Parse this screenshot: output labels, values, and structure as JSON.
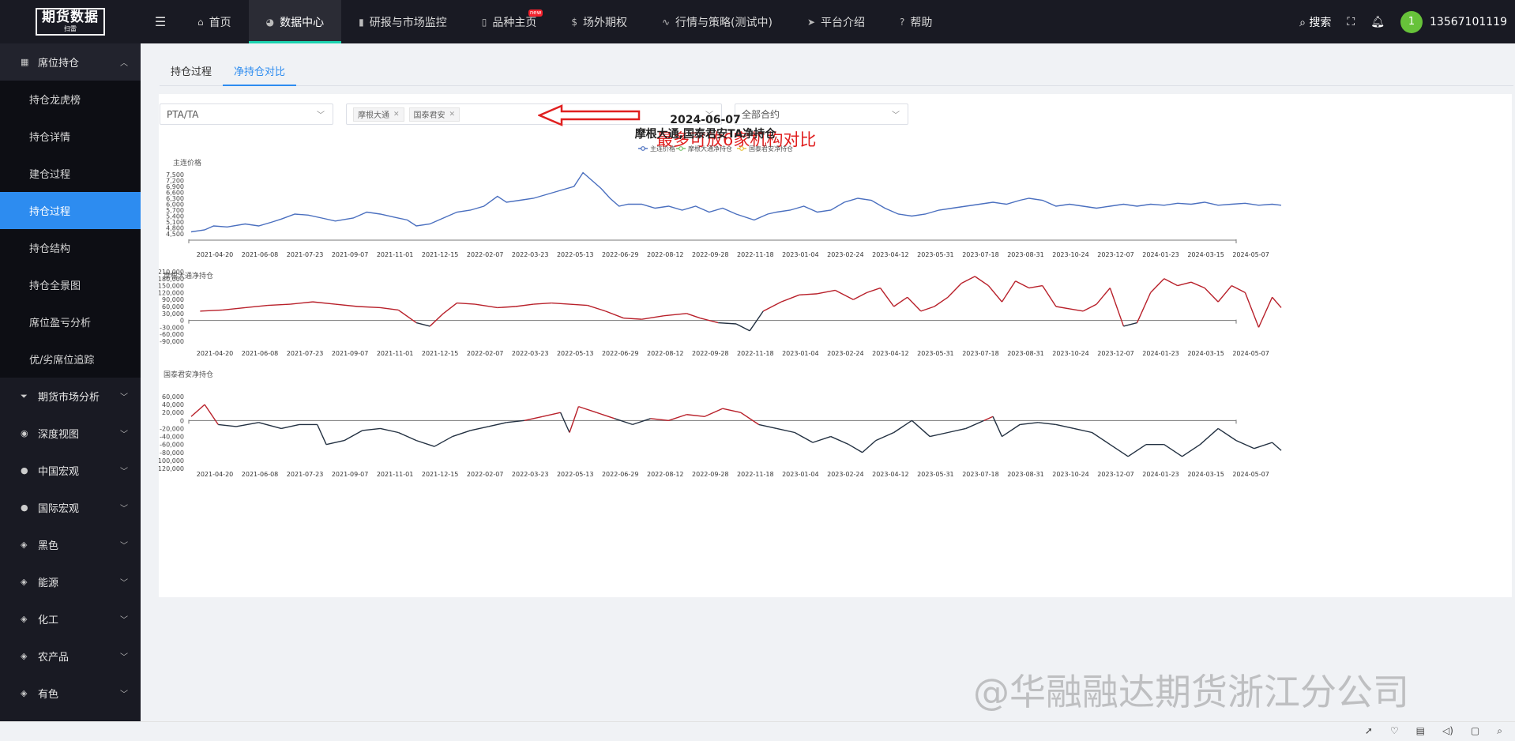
{
  "logo": {
    "title": "期货数据",
    "subtitle": "扫雷"
  },
  "nav": {
    "items": [
      {
        "label": "首页",
        "icon": "home-icon",
        "glyph": "⌂"
      },
      {
        "label": "数据中心",
        "icon": "pie-icon",
        "glyph": "◕"
      },
      {
        "label": "研报与市场监控",
        "icon": "bar-chart-icon",
        "glyph": "▮"
      },
      {
        "label": "品种主页",
        "icon": "book-icon",
        "glyph": "▯",
        "badge": "new"
      },
      {
        "label": "场外期权",
        "icon": "dollar-icon",
        "glyph": "$"
      },
      {
        "label": "行情与策略(测试中)",
        "icon": "pulse-icon",
        "glyph": "∿"
      },
      {
        "label": "平台介绍",
        "icon": "send-icon",
        "glyph": "➤"
      },
      {
        "label": "帮助",
        "icon": "help-icon",
        "glyph": "?"
      }
    ],
    "active_index": 1
  },
  "topright": {
    "search_label": "搜索",
    "avatar_text": "1",
    "username": "13567101119"
  },
  "sidebar": {
    "open_group": "席位持仓",
    "sub_items": [
      "持仓龙虎榜",
      "持仓详情",
      "建仓过程",
      "持仓过程",
      "持仓结构",
      "持仓全景图",
      "席位盈亏分析",
      "优/劣席位追踪"
    ],
    "active_sub": 3,
    "groups": [
      {
        "label": "期货市场分析",
        "icon": "funnel-icon"
      },
      {
        "label": "深度视图",
        "icon": "eye-icon"
      },
      {
        "label": "中国宏观",
        "icon": "dot-icon"
      },
      {
        "label": "国际宏观",
        "icon": "dot-icon"
      },
      {
        "label": "黑色",
        "icon": "cube-icon"
      },
      {
        "label": "能源",
        "icon": "cube-icon"
      },
      {
        "label": "化工",
        "icon": "cube-icon"
      },
      {
        "label": "农产品",
        "icon": "cube-icon"
      },
      {
        "label": "有色",
        "icon": "cube-icon"
      }
    ]
  },
  "tabs": [
    {
      "label": "持仓过程"
    },
    {
      "label": "净持仓对比"
    }
  ],
  "active_tab": 1,
  "filters": {
    "variety": "PTA/TA",
    "institutions": [
      "摩根大通",
      "国泰君安"
    ],
    "contract": "全部合约",
    "annotation": "最多可放6家机构对比"
  },
  "chart_data": {
    "type": "line",
    "title": "2024-06-07",
    "subtitle": "摩根大通,国泰君安TA净持仓",
    "legend": [
      "主连价格",
      "摩根大通净持仓",
      "国泰君安净持仓"
    ],
    "legend_position": "top-center",
    "colors": {
      "price": "#4a6fbf",
      "positive": "#b8202a",
      "negative": "#223041",
      "axis": "#777777"
    },
    "x_ticks": [
      "2021-04-20",
      "2021-06-08",
      "2021-07-23",
      "2021-09-07",
      "2021-11-01",
      "2021-12-15",
      "2022-02-07",
      "2022-03-23",
      "2022-05-13",
      "2022-06-29",
      "2022-08-12",
      "2022-09-28",
      "2022-11-18",
      "2023-01-04",
      "2023-02-24",
      "2023-04-12",
      "2023-05-31",
      "2023-07-18",
      "2023-08-31",
      "2023-10-24",
      "2023-12-07",
      "2024-01-23",
      "2024-03-15",
      "2024-05-07"
    ],
    "panels": [
      {
        "name": "主连价格",
        "ylabel": "主连价格",
        "y_ticks": [
          4500,
          4800,
          5100,
          5400,
          5700,
          6000,
          6300,
          6600,
          6900,
          7200,
          7500
        ],
        "ylim": [
          4500,
          7800
        ],
        "points": [
          [
            0,
            4600
          ],
          [
            0.3,
            4700
          ],
          [
            0.5,
            4900
          ],
          [
            0.8,
            4850
          ],
          [
            1.2,
            5000
          ],
          [
            1.5,
            4900
          ],
          [
            1.8,
            5100
          ],
          [
            2.0,
            5250
          ],
          [
            2.3,
            5500
          ],
          [
            2.6,
            5450
          ],
          [
            2.9,
            5300
          ],
          [
            3.2,
            5150
          ],
          [
            3.6,
            5300
          ],
          [
            3.9,
            5600
          ],
          [
            4.2,
            5500
          ],
          [
            4.5,
            5350
          ],
          [
            4.8,
            5200
          ],
          [
            5.0,
            4900
          ],
          [
            5.3,
            5000
          ],
          [
            5.6,
            5300
          ],
          [
            5.9,
            5600
          ],
          [
            6.2,
            5700
          ],
          [
            6.5,
            5900
          ],
          [
            6.8,
            6400
          ],
          [
            7.0,
            6100
          ],
          [
            7.3,
            6200
          ],
          [
            7.6,
            6300
          ],
          [
            7.9,
            6500
          ],
          [
            8.2,
            6700
          ],
          [
            8.5,
            6900
          ],
          [
            8.7,
            7600
          ],
          [
            8.9,
            7200
          ],
          [
            9.1,
            6800
          ],
          [
            9.3,
            6300
          ],
          [
            9.5,
            5900
          ],
          [
            9.7,
            6000
          ],
          [
            10.0,
            6000
          ],
          [
            10.3,
            5800
          ],
          [
            10.6,
            5900
          ],
          [
            10.9,
            5700
          ],
          [
            11.2,
            5900
          ],
          [
            11.5,
            5600
          ],
          [
            11.8,
            5800
          ],
          [
            12.1,
            5500
          ],
          [
            12.5,
            5200
          ],
          [
            12.8,
            5500
          ],
          [
            13.0,
            5600
          ],
          [
            13.3,
            5700
          ],
          [
            13.6,
            5900
          ],
          [
            13.9,
            5600
          ],
          [
            14.2,
            5700
          ],
          [
            14.5,
            6100
          ],
          [
            14.8,
            6300
          ],
          [
            15.1,
            6200
          ],
          [
            15.4,
            5800
          ],
          [
            15.7,
            5500
          ],
          [
            16.0,
            5400
          ],
          [
            16.3,
            5500
          ],
          [
            16.6,
            5700
          ],
          [
            16.9,
            5800
          ],
          [
            17.2,
            5900
          ],
          [
            17.5,
            6000
          ],
          [
            17.8,
            6100
          ],
          [
            18.1,
            6000
          ],
          [
            18.4,
            6200
          ],
          [
            18.6,
            6300
          ],
          [
            18.9,
            6200
          ],
          [
            19.2,
            5900
          ],
          [
            19.5,
            6000
          ],
          [
            19.8,
            5900
          ],
          [
            20.1,
            5800
          ],
          [
            20.4,
            5900
          ],
          [
            20.7,
            6000
          ],
          [
            21.0,
            5900
          ],
          [
            21.3,
            6000
          ],
          [
            21.6,
            5950
          ],
          [
            21.9,
            6050
          ],
          [
            22.2,
            6000
          ],
          [
            22.5,
            6100
          ],
          [
            22.8,
            5950
          ],
          [
            23.1,
            6000
          ],
          [
            23.4,
            6050
          ],
          [
            23.7,
            5950
          ],
          [
            24.0,
            6000
          ],
          [
            24.2,
            5950
          ]
        ]
      },
      {
        "name": "摩根大通净持仓",
        "ylabel": "摩根大通净持仓",
        "y_ticks": [
          -90000,
          -60000,
          -30000,
          0,
          30000,
          60000,
          90000,
          120000,
          150000,
          180000,
          210000
        ],
        "ylim": [
          -90000,
          210000
        ],
        "points": [
          [
            0.2,
            40000
          ],
          [
            0.7,
            45000
          ],
          [
            1.2,
            55000
          ],
          [
            1.7,
            65000
          ],
          [
            2.2,
            70000
          ],
          [
            2.7,
            80000
          ],
          [
            3.2,
            70000
          ],
          [
            3.7,
            60000
          ],
          [
            4.2,
            55000
          ],
          [
            4.6,
            45000
          ],
          [
            5.0,
            -10000
          ],
          [
            5.3,
            -25000
          ],
          [
            5.6,
            30000
          ],
          [
            5.9,
            75000
          ],
          [
            6.3,
            70000
          ],
          [
            6.8,
            55000
          ],
          [
            7.2,
            60000
          ],
          [
            7.6,
            70000
          ],
          [
            8.0,
            75000
          ],
          [
            8.4,
            70000
          ],
          [
            8.8,
            65000
          ],
          [
            9.2,
            40000
          ],
          [
            9.6,
            10000
          ],
          [
            10.0,
            5000
          ],
          [
            10.5,
            20000
          ],
          [
            11.0,
            30000
          ],
          [
            11.3,
            10000
          ],
          [
            11.7,
            -10000
          ],
          [
            12.1,
            -15000
          ],
          [
            12.4,
            -45000
          ],
          [
            12.7,
            40000
          ],
          [
            13.1,
            80000
          ],
          [
            13.5,
            110000
          ],
          [
            13.9,
            115000
          ],
          [
            14.3,
            130000
          ],
          [
            14.7,
            90000
          ],
          [
            15.0,
            120000
          ],
          [
            15.3,
            140000
          ],
          [
            15.6,
            60000
          ],
          [
            15.9,
            100000
          ],
          [
            16.2,
            40000
          ],
          [
            16.5,
            60000
          ],
          [
            16.8,
            100000
          ],
          [
            17.1,
            160000
          ],
          [
            17.4,
            190000
          ],
          [
            17.7,
            150000
          ],
          [
            18.0,
            80000
          ],
          [
            18.3,
            170000
          ],
          [
            18.6,
            140000
          ],
          [
            18.9,
            150000
          ],
          [
            19.2,
            60000
          ],
          [
            19.5,
            50000
          ],
          [
            19.8,
            40000
          ],
          [
            20.1,
            70000
          ],
          [
            20.4,
            140000
          ],
          [
            20.7,
            -25000
          ],
          [
            21.0,
            -10000
          ],
          [
            21.3,
            120000
          ],
          [
            21.6,
            180000
          ],
          [
            21.9,
            150000
          ],
          [
            22.2,
            165000
          ],
          [
            22.5,
            140000
          ],
          [
            22.8,
            80000
          ],
          [
            23.1,
            150000
          ],
          [
            23.4,
            120000
          ],
          [
            23.7,
            -30000
          ],
          [
            24.0,
            100000
          ],
          [
            24.2,
            55000
          ]
        ]
      },
      {
        "name": "国泰君安净持仓",
        "ylabel": "国泰君安净持仓",
        "y_ticks": [
          -120000,
          -100000,
          -80000,
          -60000,
          -40000,
          -20000,
          0,
          20000,
          40000,
          60000
        ],
        "ylim": [
          -120000,
          60000
        ],
        "points": [
          [
            0,
            10000
          ],
          [
            0.3,
            40000
          ],
          [
            0.6,
            -10000
          ],
          [
            1.0,
            -15000
          ],
          [
            1.5,
            -5000
          ],
          [
            2.0,
            -20000
          ],
          [
            2.4,
            -10000
          ],
          [
            2.8,
            -10000
          ],
          [
            3.0,
            -60000
          ],
          [
            3.4,
            -50000
          ],
          [
            3.8,
            -25000
          ],
          [
            4.2,
            -20000
          ],
          [
            4.6,
            -30000
          ],
          [
            5.0,
            -50000
          ],
          [
            5.4,
            -65000
          ],
          [
            5.8,
            -40000
          ],
          [
            6.2,
            -25000
          ],
          [
            6.6,
            -15000
          ],
          [
            7.0,
            -5000
          ],
          [
            7.4,
            0
          ],
          [
            7.8,
            10000
          ],
          [
            8.2,
            20000
          ],
          [
            8.4,
            -30000
          ],
          [
            8.6,
            35000
          ],
          [
            9.0,
            20000
          ],
          [
            9.4,
            5000
          ],
          [
            9.8,
            -10000
          ],
          [
            10.2,
            5000
          ],
          [
            10.6,
            0
          ],
          [
            11.0,
            15000
          ],
          [
            11.4,
            10000
          ],
          [
            11.8,
            30000
          ],
          [
            12.2,
            20000
          ],
          [
            12.6,
            -10000
          ],
          [
            13.0,
            -20000
          ],
          [
            13.4,
            -30000
          ],
          [
            13.8,
            -55000
          ],
          [
            14.2,
            -40000
          ],
          [
            14.6,
            -60000
          ],
          [
            14.9,
            -80000
          ],
          [
            15.2,
            -50000
          ],
          [
            15.6,
            -30000
          ],
          [
            16.0,
            0
          ],
          [
            16.4,
            -40000
          ],
          [
            16.8,
            -30000
          ],
          [
            17.2,
            -20000
          ],
          [
            17.6,
            0
          ],
          [
            17.8,
            10000
          ],
          [
            18.0,
            -40000
          ],
          [
            18.4,
            -10000
          ],
          [
            18.8,
            -5000
          ],
          [
            19.2,
            -10000
          ],
          [
            19.6,
            -20000
          ],
          [
            20.0,
            -30000
          ],
          [
            20.4,
            -60000
          ],
          [
            20.8,
            -90000
          ],
          [
            21.2,
            -60000
          ],
          [
            21.6,
            -60000
          ],
          [
            22.0,
            -90000
          ],
          [
            22.4,
            -60000
          ],
          [
            22.8,
            -20000
          ],
          [
            23.2,
            -50000
          ],
          [
            23.6,
            -70000
          ],
          [
            24.0,
            -55000
          ],
          [
            24.2,
            -75000
          ]
        ]
      }
    ]
  },
  "watermark": "@华融融达期货浙江分公司",
  "bottom_icons": [
    "rocket-icon",
    "heart-icon",
    "trash-icon",
    "volume-icon",
    "window-icon",
    "search-icon"
  ]
}
